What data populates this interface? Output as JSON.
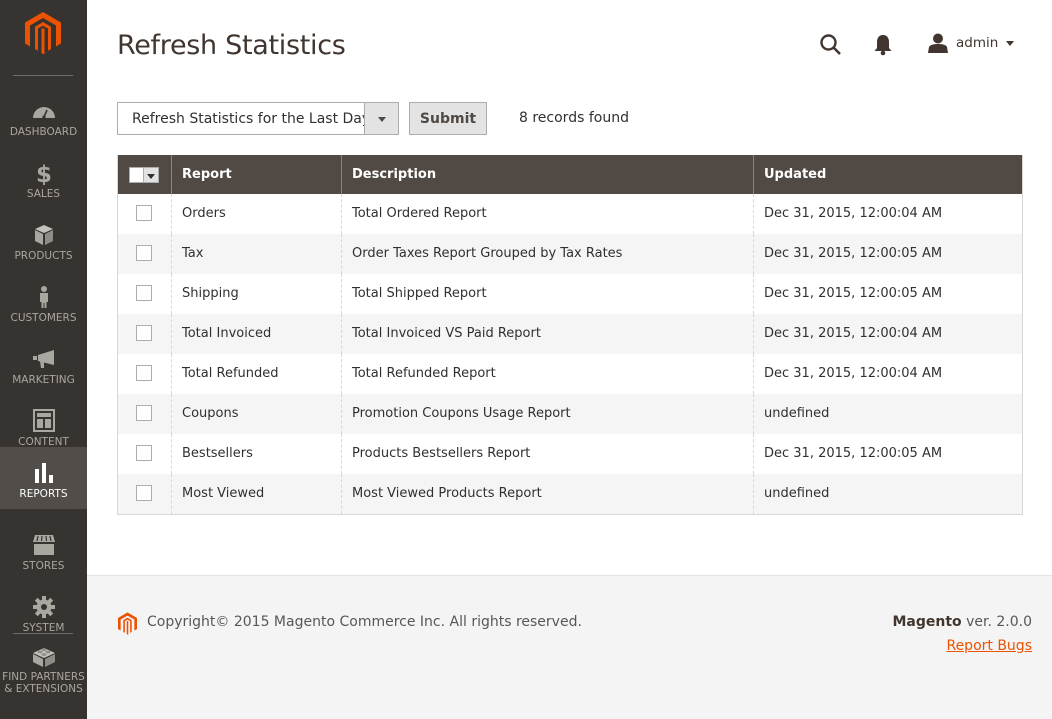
{
  "brand": {
    "accent": "#eb5202",
    "sidebar_bg": "#373330",
    "header_bg": "#514943"
  },
  "sidebar": {
    "items": [
      {
        "id": "dashboard",
        "label": "DASHBOARD",
        "icon": "dashboard-gauge-icon",
        "active": false
      },
      {
        "id": "sales",
        "label": "SALES",
        "icon": "dollar-icon",
        "active": false
      },
      {
        "id": "products",
        "label": "PRODUCTS",
        "icon": "box-icon",
        "active": false
      },
      {
        "id": "customers",
        "label": "CUSTOMERS",
        "icon": "person-icon",
        "active": false
      },
      {
        "id": "marketing",
        "label": "MARKETING",
        "icon": "megaphone-icon",
        "active": false
      },
      {
        "id": "content",
        "label": "CONTENT",
        "icon": "layout-icon",
        "active": false
      },
      {
        "id": "reports",
        "label": "REPORTS",
        "icon": "bar-chart-icon",
        "active": true
      },
      {
        "id": "stores",
        "label": "STORES",
        "icon": "storefront-icon",
        "active": false
      },
      {
        "id": "system",
        "label": "SYSTEM",
        "icon": "gear-icon",
        "active": false
      },
      {
        "id": "partners",
        "label": "FIND PARTNERS & EXTENSIONS",
        "label_line1": "FIND PARTNERS",
        "label_line2": "& EXTENSIONS",
        "icon": "lego-brick-icon",
        "active": false
      }
    ]
  },
  "header": {
    "title": "Refresh Statistics",
    "user": "admin"
  },
  "controls": {
    "action_select": "Refresh Statistics for the Last Day",
    "submit_label": "Submit",
    "records_found": "8 records found"
  },
  "grid": {
    "columns": [
      "Report",
      "Description",
      "Updated"
    ],
    "rows": [
      {
        "report": "Orders",
        "description": "Total Ordered Report",
        "updated": "Dec 31, 2015, 12:00:04 AM"
      },
      {
        "report": "Tax",
        "description": "Order Taxes Report Grouped by Tax Rates",
        "updated": "Dec 31, 2015, 12:00:05 AM"
      },
      {
        "report": "Shipping",
        "description": "Total Shipped Report",
        "updated": "Dec 31, 2015, 12:00:05 AM"
      },
      {
        "report": "Total Invoiced",
        "description": "Total Invoiced VS Paid Report",
        "updated": "Dec 31, 2015, 12:00:04 AM"
      },
      {
        "report": "Total Refunded",
        "description": "Total Refunded Report",
        "updated": "Dec 31, 2015, 12:00:04 AM"
      },
      {
        "report": "Coupons",
        "description": "Promotion Coupons Usage Report",
        "updated": "undefined"
      },
      {
        "report": "Bestsellers",
        "description": "Products Bestsellers Report",
        "updated": "Dec 31, 2015, 12:00:05 AM"
      },
      {
        "report": "Most Viewed",
        "description": "Most Viewed Products Report",
        "updated": "undefined"
      }
    ]
  },
  "footer": {
    "copyright": "Copyright© 2015 Magento Commerce Inc. All rights reserved.",
    "product": "Magento",
    "version": " ver. 2.0.0",
    "report_bugs": "Report Bugs"
  }
}
